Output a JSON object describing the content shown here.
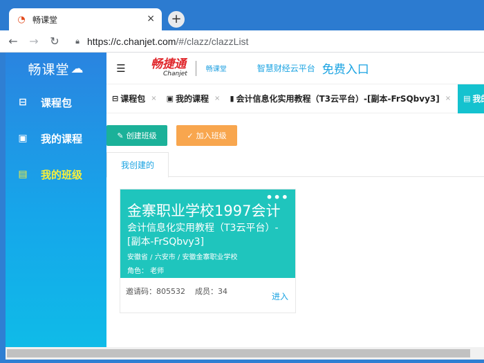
{
  "browser": {
    "tab_title": "畅课堂",
    "tab_close": "×",
    "new_tab": "+",
    "url_host": "https://c.chanjet.com",
    "url_path": "/#/clazz/clazzList"
  },
  "sidebar": {
    "logo": "畅课堂",
    "items": [
      {
        "label": "课程包"
      },
      {
        "label": "我的课程"
      },
      {
        "label": "我的班级"
      }
    ]
  },
  "topbar": {
    "brand": "畅捷通",
    "brand_sub": "Chanjet",
    "brand_mini": "畅课堂",
    "slogan": "智慧财经云平台",
    "free_entry": "免费入口"
  },
  "page_tabs": [
    {
      "label": "课程包",
      "close": "×"
    },
    {
      "label": "我的课程",
      "close": "×"
    },
    {
      "label": "会计信息化实用教程（T3云平台）-[副本-FrSQbvy3]",
      "close": "×"
    },
    {
      "label": "我的"
    }
  ],
  "actions": {
    "create_class": "创建班级",
    "join_class": "加入班级"
  },
  "subtabs": {
    "created_by_me": "我创建的"
  },
  "card": {
    "more": "•••",
    "school": "金寨职业学校1997会计",
    "course": "会计信息化实用教程（T3云平台）-[副本-FrSQbvy3]",
    "region": "安徽省 / 六安市 / 安徽金寨职业学校",
    "role": "角色： 老师",
    "invite_code": "邀请码：805532",
    "members": "成员：34",
    "enter": "进入"
  },
  "colors": {
    "sidebar_top": "#2a84e0",
    "sidebar_bottom": "#0fbbe8",
    "active_item": "#f7ef3c",
    "card_head": "#1fc5bd",
    "btn_create": "#1bb199",
    "btn_join": "#f8a64e",
    "link": "#1aa3e2"
  }
}
